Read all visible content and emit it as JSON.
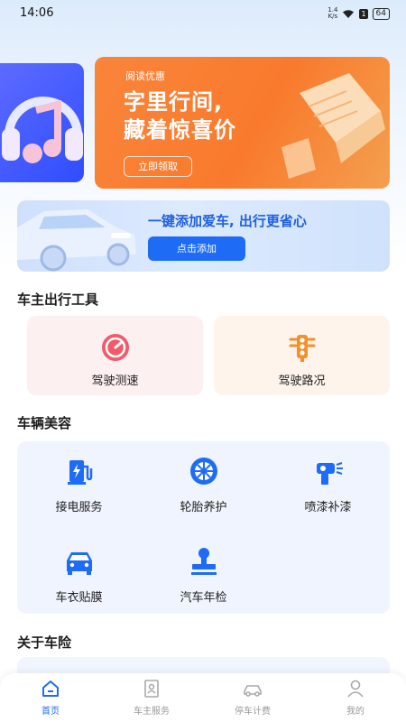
{
  "status_bar": {
    "time": "14:06",
    "net_speed_top": "1.4",
    "net_speed_bottom": "K/s",
    "sim": "1",
    "battery": "64"
  },
  "banner": {
    "kicker": "阅读优惠",
    "title_line1": "字里行间,",
    "title_line2": "藏着惊喜价",
    "button": "立即领取"
  },
  "add_car": {
    "text": "一键添加爱车, 出行更省心",
    "button": "点击添加"
  },
  "sections": {
    "tools": "车主出行工具",
    "beauty": "车辆美容",
    "insurance": "关于车险"
  },
  "tools": [
    {
      "label": "驾驶测速",
      "icon": "speedometer-icon"
    },
    {
      "label": "驾驶路况",
      "icon": "traffic-light-icon"
    }
  ],
  "beauty": [
    {
      "label": "接电服务",
      "icon": "charging-station-icon"
    },
    {
      "label": "轮胎养护",
      "icon": "tire-icon"
    },
    {
      "label": "喷漆补漆",
      "icon": "spray-gun-icon"
    },
    {
      "label": "车衣贴膜",
      "icon": "car-icon"
    },
    {
      "label": "汽车年检",
      "icon": "stamp-icon"
    }
  ],
  "tabs": [
    {
      "label": "首页",
      "icon": "home-icon",
      "active": true
    },
    {
      "label": "车主服务",
      "icon": "id-card-icon",
      "active": false
    },
    {
      "label": "停车计费",
      "icon": "car-outline-icon",
      "active": false
    },
    {
      "label": "我的",
      "icon": "user-icon",
      "active": false
    }
  ],
  "colors": {
    "primary": "#1e6cf5",
    "banner_orange": "#f97a2d",
    "tool_pink": "#fdf0f1",
    "tool_orange": "#fef4ec",
    "panel_blue": "#eff4fe"
  }
}
